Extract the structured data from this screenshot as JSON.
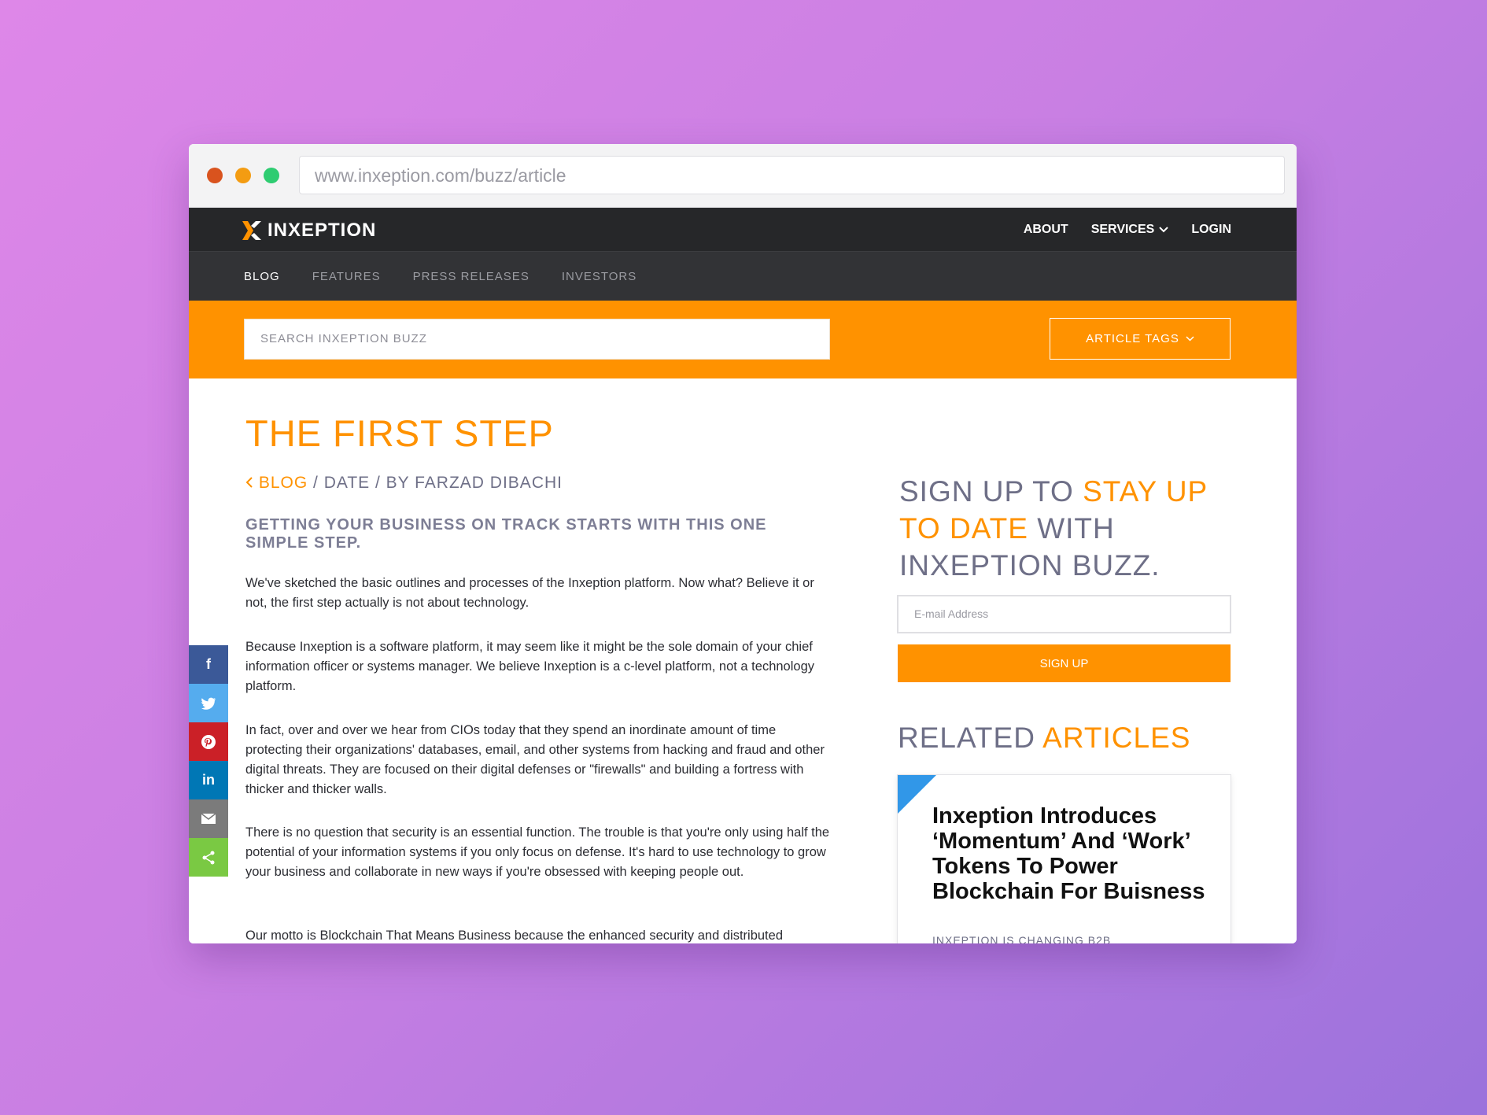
{
  "browser": {
    "url": "www.inxeption.com/buzz/article"
  },
  "brand": {
    "name": "INXEPTION",
    "orange": "#ff9200",
    "dark": "#262729"
  },
  "topnav": {
    "about": "ABOUT",
    "services": "SERVICES",
    "login": "LOGIN"
  },
  "subnav": {
    "blog": "BLOG",
    "features": "FEATURES",
    "press": "PRESS RELEASES",
    "investors": "INVESTORS"
  },
  "searchbar": {
    "placeholder": "SEARCH INXEPTION BUZZ",
    "tags_label": "ARTICLE TAGS"
  },
  "article": {
    "title": "THE FIRST STEP",
    "crumb_blog": "BLOG",
    "crumb_rest": " / DATE / BY FARZAD DIBACHI",
    "lead": "GETTING YOUR BUSINESS ON TRACK STARTS WITH THIS ONE SIMPLE STEP.",
    "paragraphs": [
      "We've sketched the basic outlines and processes of the Inxeption platform. Now what? Believe it or not, the first step actually is not about technology.",
      "Because Inxeption is a software platform, it may seem like it might be the sole domain of your chief information officer or systems manager. We believe Inxeption is a c-level platform, not a technology platform.",
      "In fact, over and over we hear from CIOs today that they spend an inordinate amount of time protecting their organizations' databases, email, and other systems from hacking and fraud and other digital threats. They are focused on their digital defenses or \"firewalls\" and building a fortress with thicker and thicker walls.",
      "There is no question that security is an essential function. The trouble is that you're only using half the potential of your information systems if you only focus on defense. It's hard to use technology to grow your business and collaborate in new ways if you're obsessed with keeping people out.",
      "Our motto is Blockchain That Means Business because the enhanced security and distributed"
    ]
  },
  "share": {
    "facebook": "f",
    "linkedin": "in"
  },
  "signup": {
    "title_part1": "SIGN UP TO ",
    "title_highlight": "STAY UP TO DATE",
    "title_part2": " WITH INXEPTION BUZZ.",
    "email_placeholder": "E-mail Address",
    "button": "SIGN UP"
  },
  "related": {
    "title_part1": "RELATED ",
    "title_highlight": "ARTICLES",
    "card_title": "Inxeption Introduces ‘Momentum’ And ‘Work’ Tokens To Power Blockchain For Buisness",
    "card_sub": "INXEPTION IS CHANGING B2B"
  }
}
